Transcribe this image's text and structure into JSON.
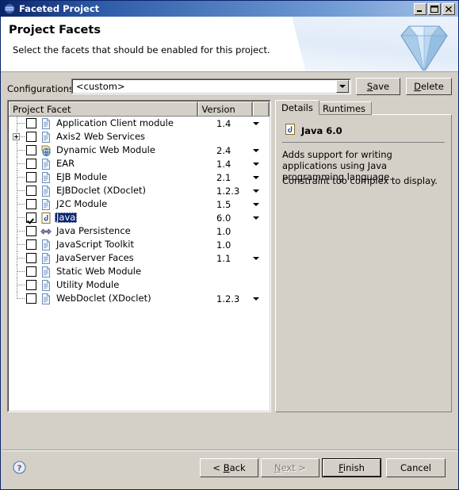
{
  "window": {
    "title": "Faceted Project",
    "icon": "eclipse-globe-icon",
    "controls": {
      "minimize": "minimize-button",
      "maximize": "maximize-button",
      "close": "close-button"
    }
  },
  "header": {
    "title": "Project Facets",
    "description": "Select the facets that should be enabled for this project.",
    "banner_icon": "diamond-gem-icon"
  },
  "configurations": {
    "label": "Configurations:",
    "value": "<custom>",
    "placeholder": "",
    "save_label": "Save",
    "save_mnemonic": "S",
    "delete_label": "Delete",
    "delete_mnemonic": "D"
  },
  "facet_table": {
    "columns": [
      "Project Facet",
      "Version",
      ""
    ],
    "rows": [
      {
        "label": "Application Client module",
        "version": "1.4",
        "checked": false,
        "expandable": false,
        "has_version_dropdown": true,
        "icon": "document-icon",
        "selected": false
      },
      {
        "label": "Axis2 Web Services",
        "version": "",
        "checked": false,
        "expandable": true,
        "has_version_dropdown": false,
        "icon": "document-icon",
        "selected": false
      },
      {
        "label": "Dynamic Web Module",
        "version": "2.4",
        "checked": false,
        "expandable": false,
        "has_version_dropdown": true,
        "icon": "web-module-icon",
        "selected": false
      },
      {
        "label": "EAR",
        "version": "1.4",
        "checked": false,
        "expandable": false,
        "has_version_dropdown": true,
        "icon": "document-icon",
        "selected": false
      },
      {
        "label": "EJB Module",
        "version": "2.1",
        "checked": false,
        "expandable": false,
        "has_version_dropdown": true,
        "icon": "document-icon",
        "selected": false
      },
      {
        "label": "EJBDoclet (XDoclet)",
        "version": "1.2.3",
        "checked": false,
        "expandable": false,
        "has_version_dropdown": true,
        "icon": "document-icon",
        "selected": false
      },
      {
        "label": "J2C Module",
        "version": "1.5",
        "checked": false,
        "expandable": false,
        "has_version_dropdown": true,
        "icon": "document-icon",
        "selected": false
      },
      {
        "label": "Java",
        "version": "6.0",
        "checked": true,
        "expandable": false,
        "has_version_dropdown": true,
        "icon": "java-icon",
        "selected": true
      },
      {
        "label": "Java Persistence",
        "version": "1.0",
        "checked": false,
        "expandable": false,
        "has_version_dropdown": false,
        "icon": "persistence-icon",
        "selected": false
      },
      {
        "label": "JavaScript Toolkit",
        "version": "1.0",
        "checked": false,
        "expandable": false,
        "has_version_dropdown": false,
        "icon": "document-icon",
        "selected": false
      },
      {
        "label": "JavaServer Faces",
        "version": "1.1",
        "checked": false,
        "expandable": false,
        "has_version_dropdown": true,
        "icon": "document-icon",
        "selected": false
      },
      {
        "label": "Static Web Module",
        "version": "",
        "checked": false,
        "expandable": false,
        "has_version_dropdown": false,
        "icon": "document-icon",
        "selected": false
      },
      {
        "label": "Utility Module",
        "version": "",
        "checked": false,
        "expandable": false,
        "has_version_dropdown": false,
        "icon": "document-icon",
        "selected": false
      },
      {
        "label": "WebDoclet (XDoclet)",
        "version": "1.2.3",
        "checked": false,
        "expandable": false,
        "has_version_dropdown": true,
        "icon": "document-icon",
        "selected": false
      }
    ]
  },
  "details": {
    "tabs": [
      {
        "label": "Details",
        "active": true
      },
      {
        "label": "Runtimes",
        "active": false
      }
    ],
    "facet_title": "Java 6.0",
    "facet_icon": "java-icon",
    "paragraph1": "Adds support for writing applications using Java programming language.",
    "paragraph2": "Constraint too complex to display."
  },
  "footer": {
    "help_icon": "help-question-icon",
    "back_label": "< Back",
    "back_mnemonic": "B",
    "next_label": "Next >",
    "next_mnemonic": "N",
    "next_disabled": true,
    "finish_label": "Finish",
    "finish_mnemonic": "F",
    "finish_default": true,
    "cancel_label": "Cancel"
  },
  "colors": {
    "title_gradient_start": "#0a246a",
    "title_gradient_end": "#a6c3e8",
    "dialog_background": "#d4d0c8",
    "selection": "#0a246a",
    "field_background": "#ffffff"
  }
}
